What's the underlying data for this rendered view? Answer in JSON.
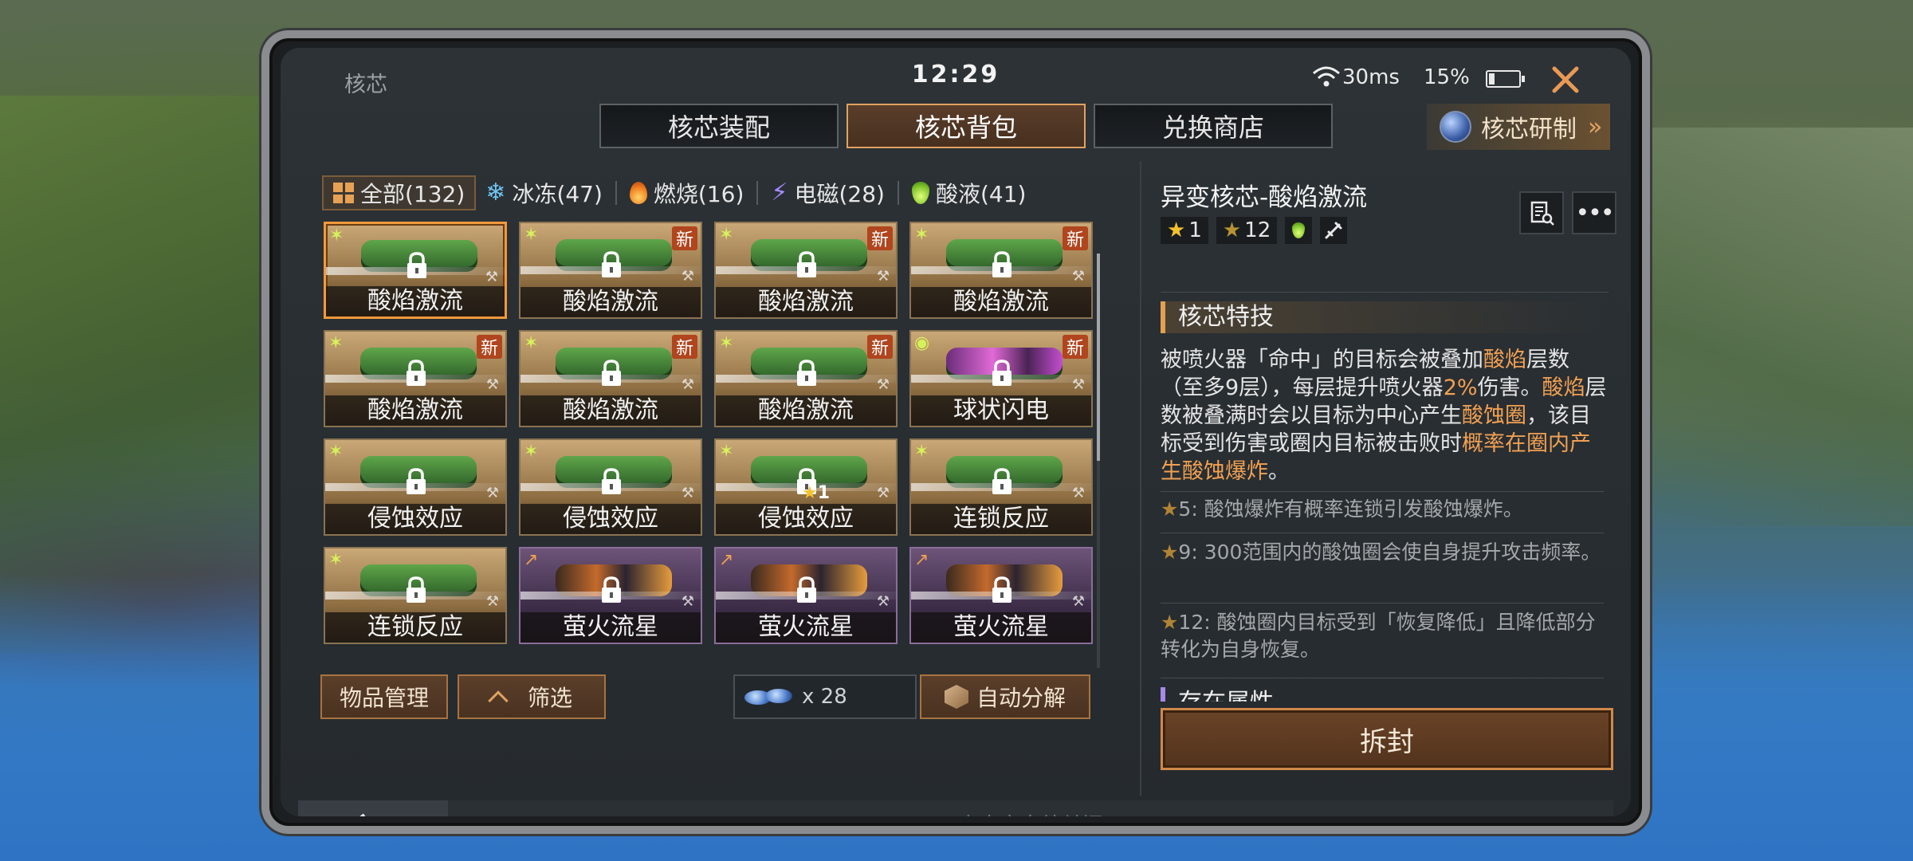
{
  "status_bar": {
    "screen_title": "核芯",
    "time": "12:29",
    "ping": "30ms",
    "battery": "15%",
    "battery_level": 0.15
  },
  "tabs": [
    {
      "label": "核芯装配",
      "active": false
    },
    {
      "label": "核芯背包",
      "active": true
    },
    {
      "label": "兑换商店",
      "active": false
    }
  ],
  "research_button": {
    "label": "核芯研制",
    "icon": "orb-icon"
  },
  "filters": [
    {
      "label": "全部(132)",
      "icon": "grid-icon",
      "active": true
    },
    {
      "label": "冰冻(47)",
      "icon": "snowflake-icon",
      "active": false
    },
    {
      "label": "燃烧(16)",
      "icon": "flame-icon",
      "active": false
    },
    {
      "label": "电磁(28)",
      "icon": "lightning-icon",
      "active": false
    },
    {
      "label": "酸液(41)",
      "icon": "acid-drop-icon",
      "active": false
    }
  ],
  "cores": [
    {
      "name": "酸焰激流",
      "rarity": "gold",
      "new": false,
      "selected": true,
      "star": ""
    },
    {
      "name": "酸焰激流",
      "rarity": "gold",
      "new": true,
      "selected": false,
      "star": ""
    },
    {
      "name": "酸焰激流",
      "rarity": "gold",
      "new": true,
      "selected": false,
      "star": ""
    },
    {
      "name": "酸焰激流",
      "rarity": "gold",
      "new": true,
      "selected": false,
      "star": ""
    },
    {
      "name": "酸焰激流",
      "rarity": "gold",
      "new": true,
      "selected": false,
      "star": ""
    },
    {
      "name": "酸焰激流",
      "rarity": "gold",
      "new": true,
      "selected": false,
      "star": ""
    },
    {
      "name": "酸焰激流",
      "rarity": "gold",
      "new": true,
      "selected": false,
      "star": ""
    },
    {
      "name": "球状闪电",
      "rarity": "gold-pink",
      "new": true,
      "selected": false,
      "star": ""
    },
    {
      "name": "侵蚀效应",
      "rarity": "gold",
      "new": false,
      "selected": false,
      "star": ""
    },
    {
      "name": "侵蚀效应",
      "rarity": "gold",
      "new": false,
      "selected": false,
      "star": ""
    },
    {
      "name": "侵蚀效应",
      "rarity": "gold",
      "new": false,
      "selected": false,
      "star": "1"
    },
    {
      "name": "连锁反应",
      "rarity": "gold",
      "new": false,
      "selected": false,
      "star": ""
    },
    {
      "name": "连锁反应",
      "rarity": "gold",
      "new": false,
      "selected": false,
      "star": ""
    },
    {
      "name": "萤火流星",
      "rarity": "purple",
      "new": false,
      "selected": false,
      "star": ""
    },
    {
      "name": "萤火流星",
      "rarity": "purple",
      "new": false,
      "selected": false,
      "star": ""
    },
    {
      "name": "萤火流星",
      "rarity": "purple",
      "new": false,
      "selected": false,
      "star": ""
    }
  ],
  "new_badge": "新",
  "bottom": {
    "manage_label": "物品管理",
    "filter_label": "筛选",
    "material_count": "x 28",
    "auto_dismantle_label": "自动分解"
  },
  "detail": {
    "title": "异变核芯-酸焰激流",
    "tag_star": "1",
    "tag_star_max": "12",
    "section_title": "核芯特技",
    "desc_parts": [
      {
        "text": "被喷火器「命中」的目标会被叠加",
        "hl": false
      },
      {
        "text": "酸焰",
        "hl": true
      },
      {
        "text": "层数（至多9层），每层提升喷火器",
        "hl": false
      },
      {
        "text": "2%",
        "hl": true
      },
      {
        "text": "伤害。",
        "hl": false
      },
      {
        "text": "酸焰",
        "hl": true
      },
      {
        "text": "层数被叠满时会以目标为中心产生",
        "hl": false
      },
      {
        "text": "酸蚀圈",
        "hl": true
      },
      {
        "text": "，该目标受到伤害或圈内目标被击败时",
        "hl": false
      },
      {
        "text": "概率在圈内产生酸蚀爆炸",
        "hl": true
      },
      {
        "text": "。",
        "hl": false
      }
    ],
    "perks": [
      {
        "stars": "5",
        "text": ": 酸蚀爆炸有概率连锁引发酸蚀爆炸。"
      },
      {
        "stars": "9",
        "text": ": 300范围内的酸蚀圈会使自身提升攻击频率。"
      },
      {
        "stars": "12",
        "text": ": 酸蚀圈内目标受到「恢复降低」且降低部分转化为自身恢复。"
      }
    ],
    "section2_title": "存在属性",
    "unseal_label": "拆封"
  },
  "footer": {
    "close_hint": "点击空白处关闭"
  },
  "colors": {
    "accent": "#e3a051",
    "selected": "#f19a3c",
    "highlight": "#f1a052",
    "new_badge": "#b0451e"
  }
}
